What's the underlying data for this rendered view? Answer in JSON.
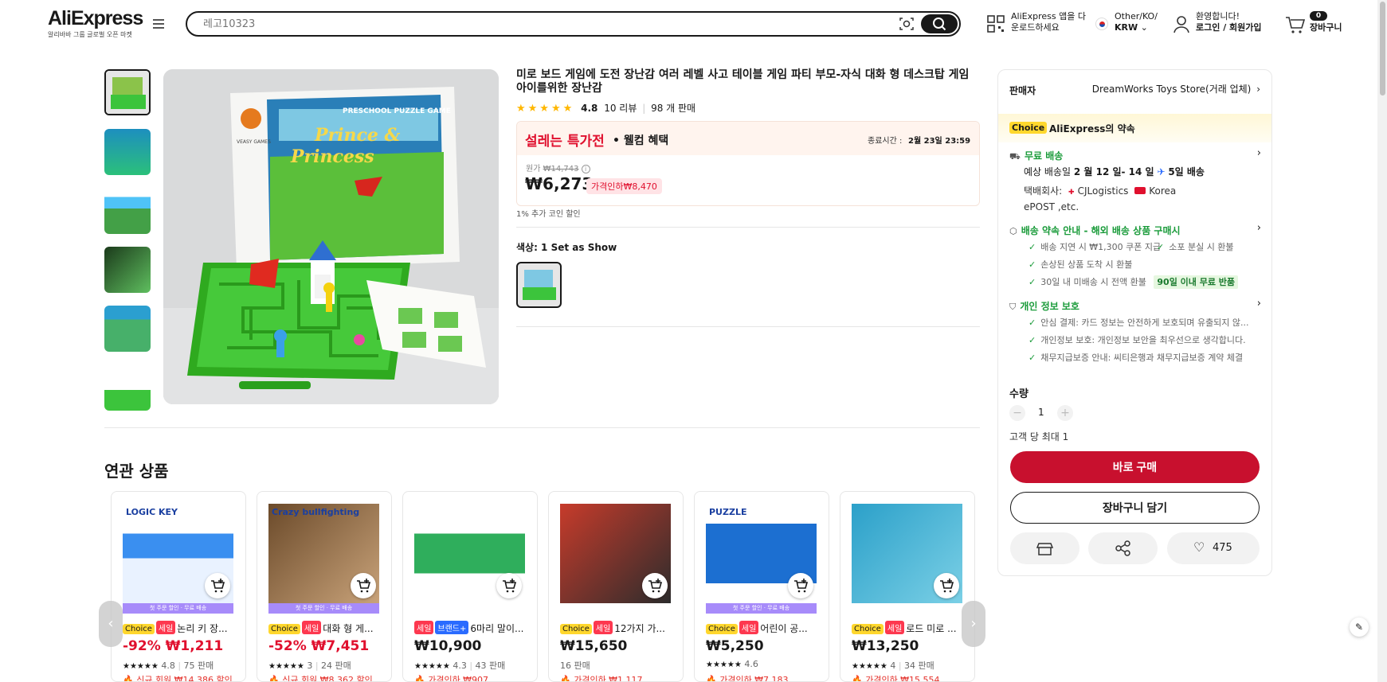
{
  "header": {
    "logo": "AliExpress",
    "logo_sub": "알리바바 그룹 글로벌 오픈 마켓",
    "search_placeholder": "레고10323",
    "app_line1": "AliExpress 앱을 다",
    "app_line2": "운로드하세요",
    "region_line1": "Other/KO/",
    "region_line2": "KRW",
    "account_line1": "환영합니다!",
    "account_line2": "로그인 / 회원가입",
    "cart_count": "0",
    "cart_label": "장바구니"
  },
  "product": {
    "title": "미로 보드 게임에 도전 장난감 여러 레벨 사고 테이블 게임 파티 부모-자식 대화 형 데스크탑 게임 아이를위한 장난감",
    "rating": "4.8",
    "reviews": "10 리뷰",
    "sold": "98 개 판매",
    "promo_title": "설레는 특가전",
    "promo_sub": "• 웰컴 혜택",
    "end_label": "종료시간 :",
    "end_time": "2월 23일 23:59",
    "orig_label": "원가",
    "orig_price": "₩14,743",
    "price": "₩6,273",
    "discount_badge": "가격인하₩8,470",
    "coin": "1% 추가 코인 할인",
    "color_label": "색상: 1 Set as Show",
    "box_title_line1": "Prince &",
    "box_title_line2": "Princess",
    "box_banner": "PRESCHOOL PUZZLE GAME",
    "box_brand": "VEASY GAMES"
  },
  "seller": {
    "label": "판매자",
    "name": "DreamWorks Toys Store(거래 업체)"
  },
  "promise": {
    "choice": "Choice",
    "title": "AliExpress의 약속",
    "free_ship": "무료 배송",
    "est_prefix": "예상 배송일",
    "est_date": "2 월 12 일- 14 일",
    "est_days": "5일 배송",
    "courier_label": "택배회사:",
    "courier1": "CJLogistics",
    "courier2": "Korea",
    "courier3": "ePOST ,etc.",
    "guarantee_title": "배송 약속 안내 - 해외 배송 상품 구매시",
    "g1": "배송 지연 시 ₩1,300 쿠폰 지급",
    "g2": "소포 분실 시 환불",
    "g3": "손상된 상품 도착 시 환불",
    "g4": "30일 내 미배송 시 전액 환불",
    "g4_badge": "90일 이내 무료 반품",
    "privacy_title": "개인 정보 보호",
    "p1": "안심 결제: 카드 정보는 안전하게 보호되며 유출되지 않...",
    "p2": "개인정보 보호: 개인정보 보안을 최우선으로 생각합니다.",
    "p3": "채무지급보증 안내: 씨티은행과 채무지급보증 계약 체결"
  },
  "purchase": {
    "qty_label": "수량",
    "qty": "1",
    "limit": "고객 당 최대 1",
    "buy_now": "바로 구매",
    "add_cart": "장바구니 담기",
    "wish_count": "475"
  },
  "related": {
    "title": "연관 상품",
    "ship_banner": "첫 주문 할인 · 무료 배송",
    "items": [
      {
        "tags": [
          "Choice",
          "세일"
        ],
        "name": "논리 키 장...",
        "price": "-92% ₩1,211",
        "rating": "4.8",
        "sold": "75 판매",
        "sub": "신규 회원 ₩14,386 할인",
        "img_text": "LOGIC KEY"
      },
      {
        "tags": [
          "Choice",
          "세일"
        ],
        "name": "대화 형 게...",
        "price": "-52% ₩7,451",
        "rating": "3",
        "sold": "24 판매",
        "sub": "신규 회원 ₩8,362 할인",
        "img_text": "Crazy bullfighting"
      },
      {
        "tags": [
          "세일",
          "브랜드+"
        ],
        "name": "6마리 말이...",
        "price": "₩10,900",
        "rating": "4.3",
        "sold": "43 판매",
        "sub": "가격인하 ₩907",
        "img_text": ""
      },
      {
        "tags": [
          "Choice",
          "세일"
        ],
        "name": "12가지 가...",
        "price": "₩15,650",
        "rating": "",
        "sold": "16 판매",
        "sub": "가격인하 ₩1,117",
        "img_text": ""
      },
      {
        "tags": [
          "Choice",
          "세일"
        ],
        "name": "어린이 공...",
        "price": "₩5,250",
        "rating": "4.6",
        "sold": "",
        "sub": "가격인하 ₩7,183",
        "img_text": "PUZZLE"
      },
      {
        "tags": [
          "Choice",
          "세일"
        ],
        "name": "로드 미로 ...",
        "price": "₩13,250",
        "rating": "4",
        "sold": "34 판매",
        "sub": "가격인하 ₩15,554",
        "img_text": ""
      }
    ]
  },
  "colors": {
    "accent_red": "#c8102e",
    "choice_yellow": "#ffd72d",
    "green": "#1a9b3a"
  }
}
